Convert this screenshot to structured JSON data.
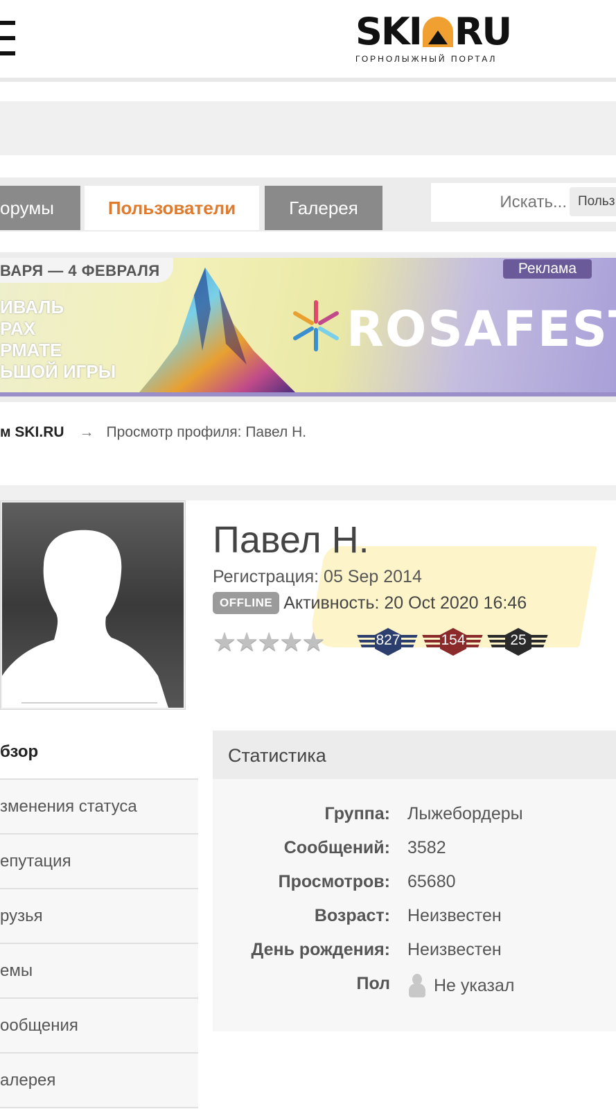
{
  "header": {
    "logo_left": "SKI",
    "logo_right": "RU",
    "logo_tagline": "ГОРНОЛЫЖНЫЙ ПОРТАЛ"
  },
  "nav": {
    "tabs": [
      {
        "label": "орумы"
      },
      {
        "label": "Пользователи"
      },
      {
        "label": "Галерея"
      }
    ],
    "search_placeholder": "Искать...",
    "search_scope": "Польз"
  },
  "banner": {
    "date_line": "ВАРЯ — 4 ФЕВРАЛЯ",
    "lines": [
      "ИВАЛЬ",
      "РАХ",
      "РМАТЕ",
      "ЬШОЙ ИГРЫ"
    ],
    "logo_text": "ROSAFEST",
    "ad_label": "Реклама"
  },
  "breadcrumb": {
    "home": "м SKI.RU",
    "arrow": "→",
    "current": "Просмотр профиля: Павел Н."
  },
  "profile": {
    "name": "Павел Н.",
    "registration_label": "Регистрация:",
    "registration_date": "05 Sep 2014",
    "status_badge": "OFFLINE",
    "activity": "Активность: 20 Oct 2020 16:46",
    "rating_stars": 0,
    "badges": [
      {
        "value": "827",
        "color": "#2c3e6e"
      },
      {
        "value": "154",
        "color": "#8a2a2a"
      },
      {
        "value": "25",
        "color": "#2a2a2a"
      }
    ]
  },
  "sidebar": {
    "items": [
      {
        "label": "бзор"
      },
      {
        "label": "зменения статуса"
      },
      {
        "label": "епутация"
      },
      {
        "label": "рузья"
      },
      {
        "label": "емы"
      },
      {
        "label": "ообщения"
      },
      {
        "label": "алерея"
      }
    ]
  },
  "stats": {
    "title": "Статистика",
    "rows": [
      {
        "label": "Группа:",
        "value": "Лыжебордеры"
      },
      {
        "label": "Сообщений:",
        "value": "3582"
      },
      {
        "label": "Просмотров:",
        "value": "65680"
      },
      {
        "label": "Возраст:",
        "value": "Неизвестен"
      },
      {
        "label": "День рождения:",
        "value": "Неизвестен"
      },
      {
        "label": "Пол",
        "value": "Не указал"
      }
    ]
  }
}
